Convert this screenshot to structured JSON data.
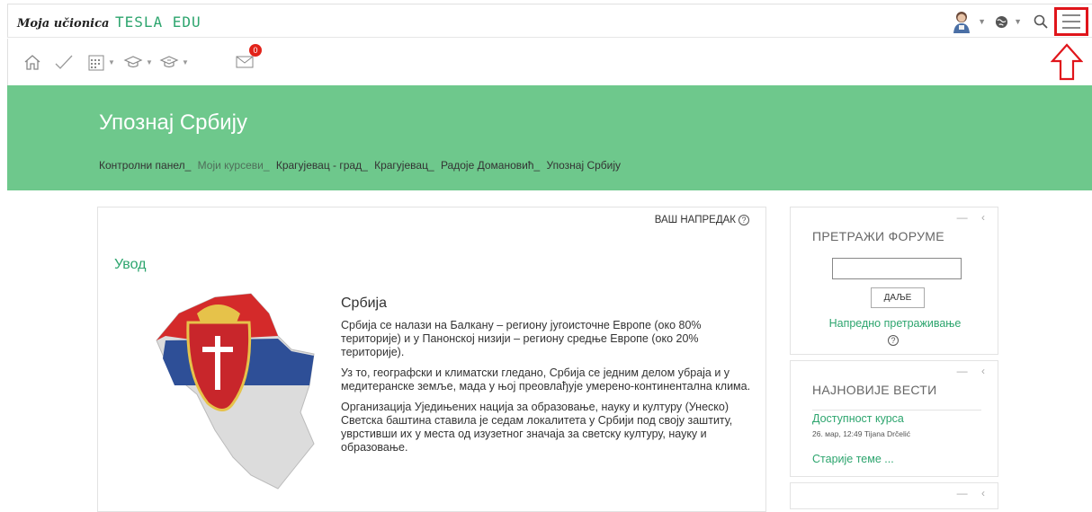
{
  "brand": {
    "prefix": "Moja učionica",
    "suffix": "TESLA EDU"
  },
  "toolbar": {
    "messages_count": "0"
  },
  "hero": {
    "title": "Упознај Србију",
    "breadcrumbs": [
      "Контролни панел_",
      "Моји курсеви_",
      "Крагујевац - град_",
      "Крагујевац_",
      "Радоје Домановић_",
      "Упознај Србију"
    ]
  },
  "main": {
    "progress_label": "ВАШ НАПРЕДАК",
    "help_glyph": "?",
    "section_title": "Увод",
    "heading": "Србија",
    "paragraphs": [
      "Србија се налази на Балкану – региону југоисточне Европе (око 80% територије) и у Панонској низији – региону средње Европе (око 20% територије).",
      "Уз то, географски и климатски гледано, Србија се једним делом убраја и у медитеранске земље, мада у њој преовлађује умерено-континентална клима.",
      "Организација Уједињених нација за образовање, науку и културу (Унеско) Светска баштина ставила је седам локалитета у Србији под своју заштиту, уврстивши их у места од изузетног значаја за светску културу, науку и образовање."
    ]
  },
  "forum_block": {
    "title": "ПРЕТРАЖИ ФОРУМЕ",
    "search_value": "",
    "go_label": "ДАЉЕ",
    "advanced_label": "Напредно претраживање"
  },
  "news_block": {
    "title": "НАЈНОВИЈЕ ВЕСТИ",
    "item_title": "Доступност курса",
    "item_meta": "26. мар, 12:49  Tijana Drčelić",
    "older_label": "Старије теме ..."
  },
  "block_controls": "— ‹",
  "colors": {
    "accent": "#2da56e",
    "hero_bg": "#6ec88c",
    "highlight": "#e0151b",
    "badge": "#e2231a"
  }
}
